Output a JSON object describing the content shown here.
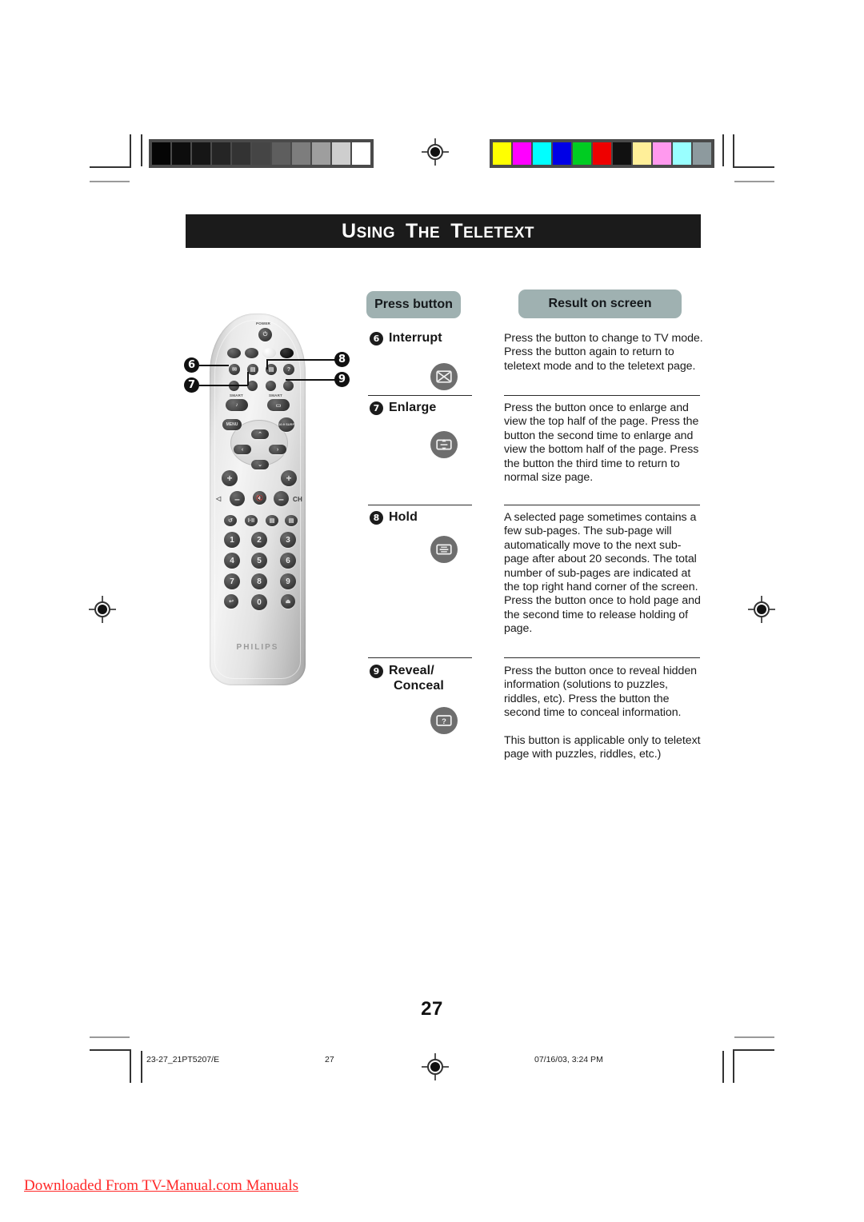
{
  "document": {
    "banner_title": "Using The Teletext",
    "banner_title_words": [
      {
        "cap": "U",
        "rest": "SING"
      },
      {
        "cap": "T",
        "rest": "HE"
      },
      {
        "cap": "T",
        "rest": "ELETEXT"
      }
    ],
    "page_number": "27",
    "watermark": "Downloaded From TV-Manual.com Manuals"
  },
  "table": {
    "header_press": "Press button",
    "header_result": "Result on screen",
    "rows": [
      {
        "number": "6",
        "label": "Interrupt",
        "icon": "interrupt-crossed-box-icon",
        "description": "Press the button to change to TV mode. Press the button again to return to teletext mode and to the teletext page."
      },
      {
        "number": "7",
        "label": "Enlarge",
        "icon": "enlarge-updown-box-icon",
        "description": "Press the button once to enlarge and view the top half of the page. Press the button the second time to enlarge and view the bottom half of the page. Press the button the third time to return to normal size page."
      },
      {
        "number": "8",
        "label": "Hold",
        "icon": "hold-box-icon",
        "description": "A selected page sometimes contains a few sub-pages. The sub-page will automatically move to the next sub-page after about 20 seconds. The total number of sub-pages are indicated at the top right hand corner of the screen. Press the button once to hold page and the second time to release holding of page."
      },
      {
        "number": "9",
        "label_line1": "Reveal/",
        "label_line2": "Conceal",
        "label": "Reveal/ Conceal",
        "icon": "reveal-conceal-question-box-icon",
        "description_p1": "Press the button once to reveal hidden information (solutions to puzzles, riddles, etc). Press the button the second time to conceal information.",
        "description_p2": "This button is applicable only to teletext page with puzzles, riddles, etc.)",
        "description": "Press the button once to reveal hidden information (solutions to puzzles, riddles, etc). Press the button the second time to conceal information. This button is applicable only to teletext page with puzzles, riddles, etc.)"
      }
    ]
  },
  "remote": {
    "brand": "PHILIPS",
    "power_label": "POWER",
    "smart_left_label": "SMART",
    "smart_right_label": "SMART",
    "menu_label": "MENU",
    "surf_label": "16:9 SURF",
    "volume_label": "CH",
    "keypad": [
      "1",
      "2",
      "3",
      "4",
      "5",
      "6",
      "7",
      "8",
      "9",
      "0"
    ],
    "callouts": [
      "6",
      "7",
      "8",
      "9"
    ]
  },
  "footer": {
    "file_id": "23-27_21PT5207/E",
    "page": "27",
    "timestamp": "07/16/03, 3:24 PM"
  },
  "colors": {
    "banner_bg": "#1b1b1b",
    "pill_bg": "#9fb1b1",
    "chip_bg": "#6e6e6e",
    "watermark": "#ff2a2a",
    "grayscale_bar": [
      "#050505",
      "#0d0d0d",
      "#161616",
      "#252525",
      "#333333",
      "#454545",
      "#5e5e5e",
      "#7d7d7d",
      "#9e9e9e",
      "#cecece",
      "#ffffff"
    ],
    "color_bar": [
      "#ffff00",
      "#ff00ff",
      "#00ffff",
      "#0000e6",
      "#00cc22",
      "#ee0000",
      "#111111",
      "#ffef99",
      "#ff99ee",
      "#99ffff",
      "#8d9a9e"
    ]
  }
}
